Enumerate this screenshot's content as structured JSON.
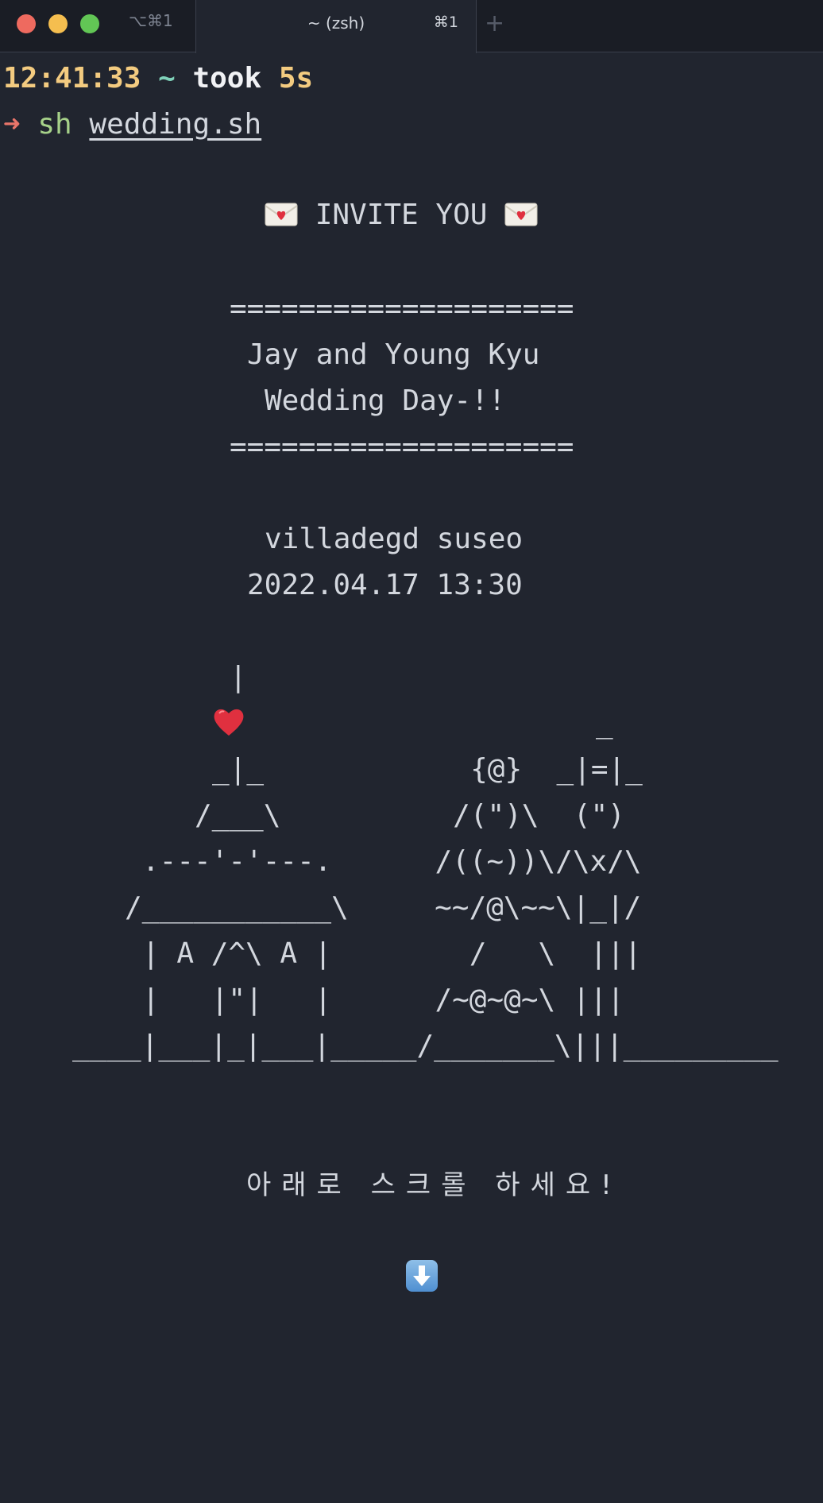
{
  "tabbar": {
    "inactive_tab_shortcut": "⌥⌘1",
    "active_tab_title": "~ (zsh)",
    "active_tab_shortcut": "⌘1",
    "new_tab_glyph": "+"
  },
  "prompt": {
    "time": "12:41:33",
    "dir": "~",
    "took_label": "took",
    "duration": "5s",
    "arrow": "➜",
    "command": "sh",
    "argument": "wedding.sh"
  },
  "invite": {
    "heading": "INVITE YOU",
    "divider": "====================",
    "names": "Jay and Young Kyu",
    "subtitle": "Wedding Day-!!",
    "venue": "villadegd suseo",
    "datetime": "2022.04.17 13:30"
  },
  "art": {
    "pole": "|",
    "flag_top": "_",
    "r1": "_|_            {@}  _|=|_",
    "r2": "/___\\          /(\")\\  (\")",
    "r3": ".---'-'---.      /((~))\\/\\x/\\",
    "r4": "/___________\\     ~~/@\\~~\\|_|/",
    "r5": "| A /^\\ A |        /   \\  |||",
    "r6": "|   |\"|   |      /~@~@~\\ |||",
    "r7": "____|___|_|___|_____/_______\\|||_________"
  },
  "footer": {
    "scroll_hint": "아래로 스크롤 하세요!"
  },
  "icons": {
    "envelope": "love-letter-icon",
    "heart": "red-heart-icon",
    "down": "down-arrow-icon"
  },
  "colors": {
    "background": "#21252f",
    "time": "#f3cb80",
    "dir": "#7fd1b9",
    "arrow": "#e8756a",
    "command": "#a6d189"
  }
}
